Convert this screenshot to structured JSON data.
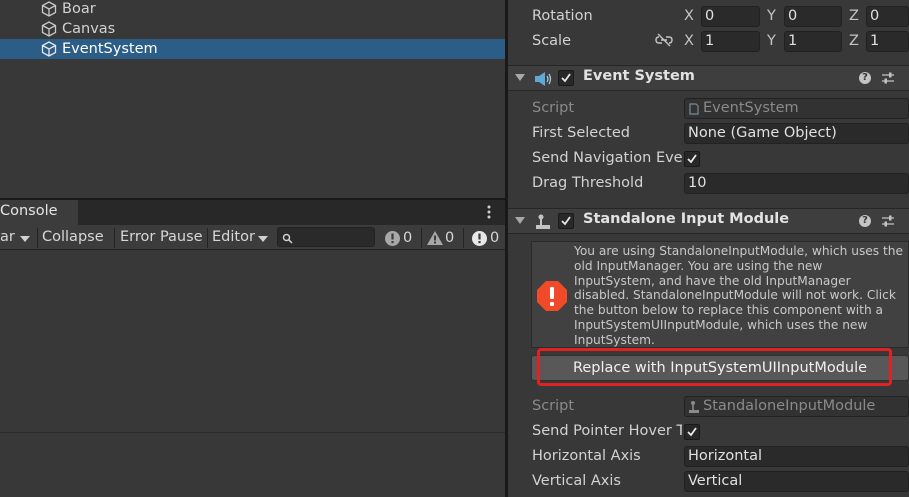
{
  "hierarchy": {
    "items": [
      {
        "label": "Boar"
      },
      {
        "label": "Canvas"
      },
      {
        "label": "EventSystem",
        "selected": true
      }
    ]
  },
  "console": {
    "tab_label": "Console",
    "toolbar": {
      "clear_partial": "ar",
      "collapse": "Collapse",
      "error_pause": "Error Pause",
      "editor": "Editor",
      "search_placeholder": "",
      "info_count": "0",
      "warning_count": "0",
      "error_count": "0"
    }
  },
  "transform": {
    "rotation_label": "Rotation",
    "scale_label": "Scale",
    "rotation": {
      "x": "0",
      "y": "0",
      "z": "0"
    },
    "scale": {
      "x": "1",
      "y": "1",
      "z": "1"
    },
    "axis_labels": {
      "x": "X",
      "y": "Y",
      "z": "Z"
    }
  },
  "event_system": {
    "title": "Event System",
    "enabled": true,
    "script_label": "Script",
    "script_value": "EventSystem",
    "first_selected_label": "First Selected",
    "first_selected_value": "None (Game Object)",
    "send_nav_label": "Send Navigation Eve",
    "send_nav_checked": true,
    "drag_threshold_label": "Drag Threshold",
    "drag_threshold_value": "10"
  },
  "standalone": {
    "title": "Standalone Input Module",
    "enabled": true,
    "warning": "You are using StandaloneInputModule, which uses the\nold InputManager. You are using the new\nInputSystem, and have the old InputManager\ndisabled. StandaloneInputModule will not work. Click\nthe button below to replace this component with a\nInputSystemUIInputModule, which uses the new\nInputSystem.",
    "replace_button": "Replace with InputSystemUIInputModule",
    "script_label": "Script",
    "script_value": "StandaloneInputModule",
    "send_pointer_label": "Send Pointer Hover T",
    "send_pointer_checked": true,
    "horizontal_axis_label": "Horizontal Axis",
    "horizontal_axis_value": "Horizontal",
    "vertical_axis_label": "Vertical Axis",
    "vertical_axis_value": "Vertical"
  },
  "colors": {
    "selection": "#2c5d87",
    "highlight": "#e02222",
    "warning_icon": "#f04a2a"
  }
}
